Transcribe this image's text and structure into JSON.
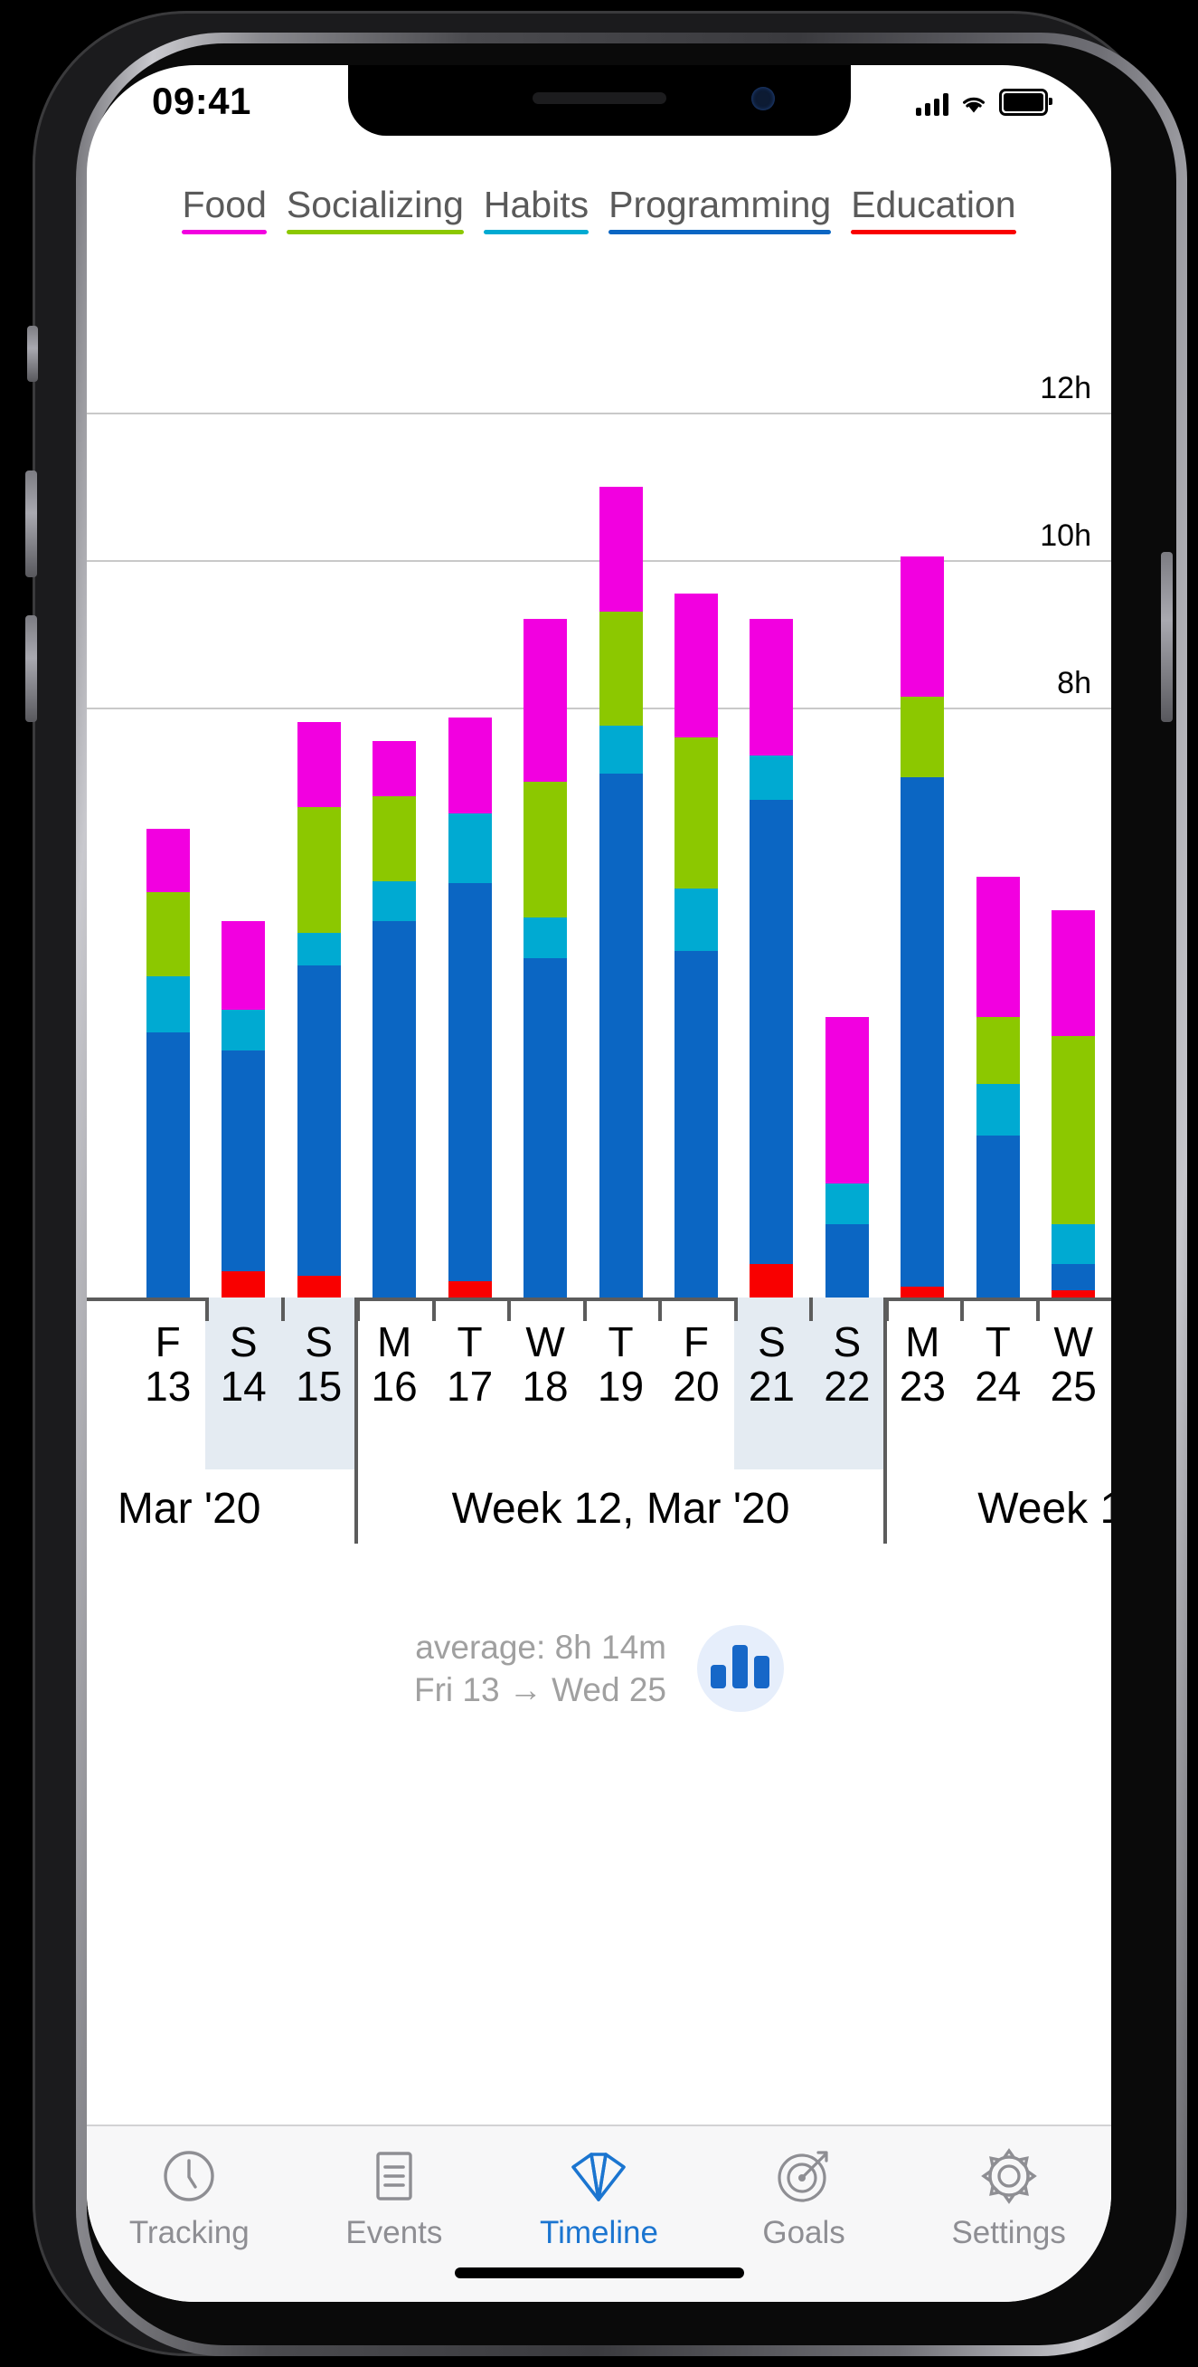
{
  "status_bar": {
    "time": "09:41",
    "signal_icon": "cellular-signal-icon",
    "wifi_icon": "wifi-icon",
    "battery_icon": "battery-icon"
  },
  "legend": {
    "items": [
      {
        "label": "Food",
        "color": "#f200e0"
      },
      {
        "label": "Socializing",
        "color": "#8cc800"
      },
      {
        "label": "Habits",
        "color": "#00aad2"
      },
      {
        "label": "Programming",
        "color": "#0b66c3"
      },
      {
        "label": "Education",
        "color": "#f90000"
      }
    ]
  },
  "chart_data": {
    "type": "bar",
    "title": "",
    "xlabel": "",
    "ylabel": "",
    "stacked": true,
    "grid": true,
    "legend_position": "top",
    "ylim": [
      0,
      13
    ],
    "yticks": [
      8,
      10,
      12
    ],
    "ytick_labels": [
      "8h",
      "10h",
      "12h"
    ],
    "categories": [
      "13",
      "14",
      "15",
      "16",
      "17",
      "18",
      "19",
      "20",
      "21",
      "22",
      "23",
      "24",
      "25"
    ],
    "x_dow": [
      "F",
      "S",
      "S",
      "M",
      "T",
      "W",
      "T",
      "F",
      "S",
      "S",
      "M",
      "T",
      "W"
    ],
    "weekend_flags": [
      false,
      true,
      true,
      false,
      false,
      false,
      false,
      false,
      true,
      true,
      false,
      false,
      false
    ],
    "series": [
      {
        "name": "Education",
        "color": "#f90000",
        "values": [
          0,
          0.35,
          0.3,
          0,
          0.22,
          0,
          0,
          0,
          0.45,
          0,
          0.15,
          0,
          0.1
        ]
      },
      {
        "name": "Programming",
        "color": "#0b66c3",
        "values": [
          3.6,
          3.0,
          4.2,
          5.1,
          5.4,
          4.6,
          7.1,
          4.7,
          6.3,
          1.0,
          6.9,
          2.2,
          0.35
        ]
      },
      {
        "name": "Habits",
        "color": "#00aad2",
        "values": [
          0.75,
          0.55,
          0.45,
          0.55,
          0.95,
          0.55,
          0.65,
          0.85,
          0.6,
          0.55,
          0,
          0.7,
          0.55
        ]
      },
      {
        "name": "Socializing",
        "color": "#8cc800",
        "values": [
          1.15,
          0.0,
          1.7,
          1.15,
          0.0,
          1.85,
          1.55,
          2.05,
          0.0,
          0.0,
          1.1,
          0.9,
          2.55
        ]
      },
      {
        "name": "Food",
        "color": "#f200e0",
        "values": [
          0.85,
          1.2,
          1.15,
          0.75,
          1.3,
          2.2,
          1.7,
          1.95,
          1.85,
          2.25,
          1.9,
          1.9,
          1.7
        ]
      }
    ],
    "weeks": [
      {
        "label": "Mar '20",
        "start_index": -2,
        "end_index": 2
      },
      {
        "label": "Week 12, Mar '20",
        "start_index": 3,
        "end_index": 9
      },
      {
        "label": "Week 1",
        "start_index": 10,
        "end_index": 14
      }
    ]
  },
  "summary": {
    "average_line": "average: 8h 14m",
    "range_line": "Fri 13 → Wed 25",
    "badge_icon": "bar-chart-icon"
  },
  "tab_bar": {
    "tabs": [
      {
        "label": "Tracking",
        "icon": "clock-icon",
        "active": false
      },
      {
        "label": "Events",
        "icon": "document-list-icon",
        "active": false
      },
      {
        "label": "Timeline",
        "icon": "fan-timeline-icon",
        "active": true
      },
      {
        "label": "Goals",
        "icon": "target-arrow-icon",
        "active": false
      },
      {
        "label": "Settings",
        "icon": "gear-icon",
        "active": false
      }
    ],
    "active_color": "#1b75d0",
    "inactive_color": "#8e8e93"
  }
}
